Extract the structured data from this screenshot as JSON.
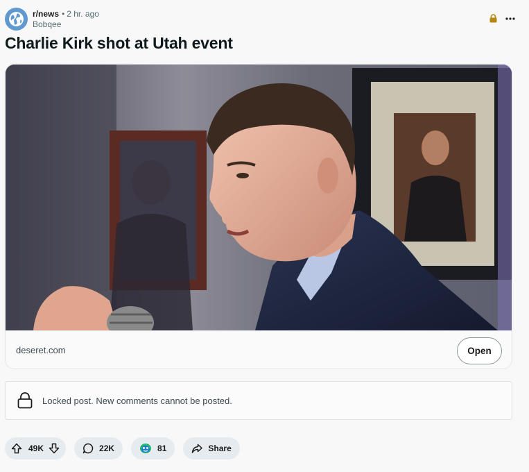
{
  "post": {
    "subreddit": "r/news",
    "separator": "•",
    "time": "2 hr. ago",
    "author": "Bobqee",
    "title": "Charlie Kirk shot at Utah event"
  },
  "link": {
    "domain": "deseret.com",
    "open_label": "Open"
  },
  "locked": {
    "message": "Locked post. New comments cannot be posted."
  },
  "actions": {
    "votes": "49K",
    "comments": "22K",
    "awards": "81",
    "share_label": "Share"
  },
  "icons": {
    "avatar": "globe-icon",
    "lock": "lock-icon",
    "overflow": "more-icon",
    "upvote": "upvote-arrow-icon",
    "downvote": "downvote-arrow-icon",
    "comment": "comment-bubble-icon",
    "award": "award-icon",
    "share": "share-arrow-icon"
  },
  "colors": {
    "lock_accent": "#b5870f",
    "avatar_bg": "#5f99cf",
    "pill_bg": "#e5ebee"
  }
}
